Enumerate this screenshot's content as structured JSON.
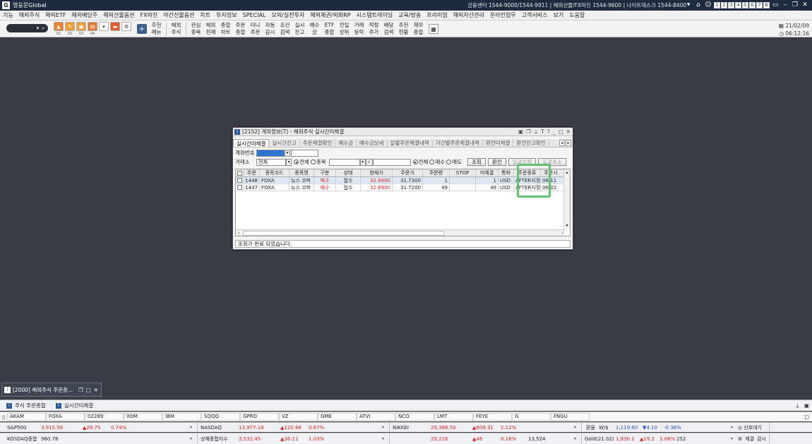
{
  "app": {
    "title": "영웅문Global",
    "centers": "금융센터 1544-9000/1544-9911 | 해외선물/FX마진 1544-9600 | 나이트데스크 1544-8400",
    "screen_numbers": [
      "1",
      "2",
      "3",
      "4",
      "5",
      "6",
      "7",
      "8"
    ]
  },
  "menu": [
    "기능",
    "해외주식",
    "해외ETF",
    "해외배당주",
    "해외선물옵션",
    "FX마진",
    "야간선물옵션",
    "차트",
    "투자정보",
    "SPECIAL",
    "모의/실전투자",
    "해외채권/외화RP",
    "시스템트레이딩",
    "교육/방송",
    "프리미엄",
    "해외자산관리",
    "온라인업무",
    "고객서비스",
    "보기",
    "도움말"
  ],
  "toolbar": {
    "icon_labels": [
      "01",
      "02",
      "03",
      "04"
    ],
    "buttons": [
      {
        "l1": "추천",
        "l2": "메뉴"
      },
      {
        "l1": "해외",
        "l2": "주식"
      },
      {
        "l1": "관심",
        "l2": "종목"
      },
      {
        "l1": "해외",
        "l2": "현재"
      },
      {
        "l1": "종합",
        "l2": "차트"
      },
      {
        "l1": "주문",
        "l2": "종합"
      },
      {
        "l1": "미니",
        "l2": "주문"
      },
      {
        "l1": "자동",
        "l2": "감시"
      },
      {
        "l1": "조건",
        "l2": "검색"
      },
      {
        "l1": "실시",
        "l2": "잔고"
      },
      {
        "l1": "예수",
        "l2": "금"
      },
      {
        "l1": "ETF",
        "l2": "종합"
      },
      {
        "l1": "전일",
        "l2": "상위"
      },
      {
        "l1": "거래",
        "l2": "등락"
      },
      {
        "l1": "적정",
        "l2": "주가"
      },
      {
        "l1": "배당",
        "l2": "검색"
      },
      {
        "l1": "추천",
        "l2": "현황"
      },
      {
        "l1": "재무",
        "l2": "종합"
      }
    ],
    "date": "21/02/09",
    "time": "06:12:16"
  },
  "window": {
    "title": "[2152] 계좌정보(T) - 해외주식 실시간미체결",
    "tabs": [
      "실시간미체결",
      "실시간잔고",
      "주문체결확인",
      "예수금",
      "예수금상세",
      "일별주문체결내역",
      "기간별주문체결내역",
      "환전미체결",
      "환전잔고확인"
    ],
    "account_label": "계좌번호",
    "exchange_label": "거래소",
    "exchange_value": "전체",
    "radio_scope": [
      "전체",
      "종목"
    ],
    "radio_side": [
      "전체",
      "매수",
      "매도"
    ],
    "buttons": {
      "search": "조회",
      "exchange": "환전",
      "modify_all": "일괄정정",
      "cancel_all": "일괄취소"
    },
    "columns": [
      "주문",
      "종목코드",
      "종목명",
      "구분",
      "상태",
      "현재가",
      "주문가",
      "주문량",
      "STOP",
      "미체결",
      "통화",
      "주문종류",
      "주문시"
    ],
    "rows": [
      {
        "order": "1448",
        "code": "FOXA",
        "name": "뉴스 코퍼",
        "side": "매수",
        "status": "접수",
        "current": "32.6900",
        "price": "31.7300",
        "qty": "1",
        "stop": "",
        "unfilled": "1",
        "currency": "USD",
        "type": "AFTER지정",
        "time": "06:11"
      },
      {
        "order": "1447",
        "code": "FOXA",
        "name": "뉴스 코퍼",
        "side": "매수",
        "status": "접수",
        "current": "32.6900",
        "price": "31.7200",
        "qty": "49",
        "stop": "",
        "unfilled": "49",
        "currency": "USD",
        "type": "AFTER지정",
        "time": "06:02"
      }
    ],
    "status_message": "조회가 완료 되었습니다."
  },
  "minimized": {
    "title": "[2000] 해외주식 주문종..."
  },
  "taskbar": {
    "items": [
      "주식 주문종합",
      "실시간미체결"
    ]
  },
  "tickers": [
    "AKAM",
    "FOXA",
    "02289",
    "XOM",
    "IBM",
    "SQQQ",
    "GPRO",
    "VZ",
    "GME",
    "ATVI",
    "NCO",
    "LMT",
    "FEYE",
    "G",
    "FNGU"
  ],
  "indices_row1": [
    {
      "name": "S&P500",
      "value": "3,915.58",
      "change": "▲28.75",
      "pct": "0.74%"
    },
    {
      "name": "NASDAQ",
      "value": "13,977.18",
      "change": "▲120.88",
      "pct": "0.87%"
    },
    {
      "name": "NIKKEI",
      "value": "29,388.50",
      "change": "▲609.31",
      "pct": "2.12%"
    }
  ],
  "indices_row2": [
    {
      "name": "KOSDAQ종합",
      "value": "960.78",
      "change": "",
      "pct": ""
    },
    {
      "name": "상해종합지수",
      "value": "3,532.45",
      "change": "▲36.11",
      "pct": "1.03%"
    },
    {
      "name": "",
      "value": "29,216",
      "change": "▲46",
      "pct": "0.16%",
      "extra": "13,524"
    }
  ],
  "fx": {
    "label": "환율",
    "pair": "W/$",
    "value": "1,119.60",
    "change": "▼4.10",
    "pct": "-0.36%"
  },
  "gold": {
    "name": "Gold(21.02)",
    "value": "1,830.1",
    "change": "▲19.2",
    "pct": "1.06%",
    "extra": "252"
  },
  "signals": {
    "label1": "신호대기",
    "label2": "체결",
    "label3": "감시"
  }
}
